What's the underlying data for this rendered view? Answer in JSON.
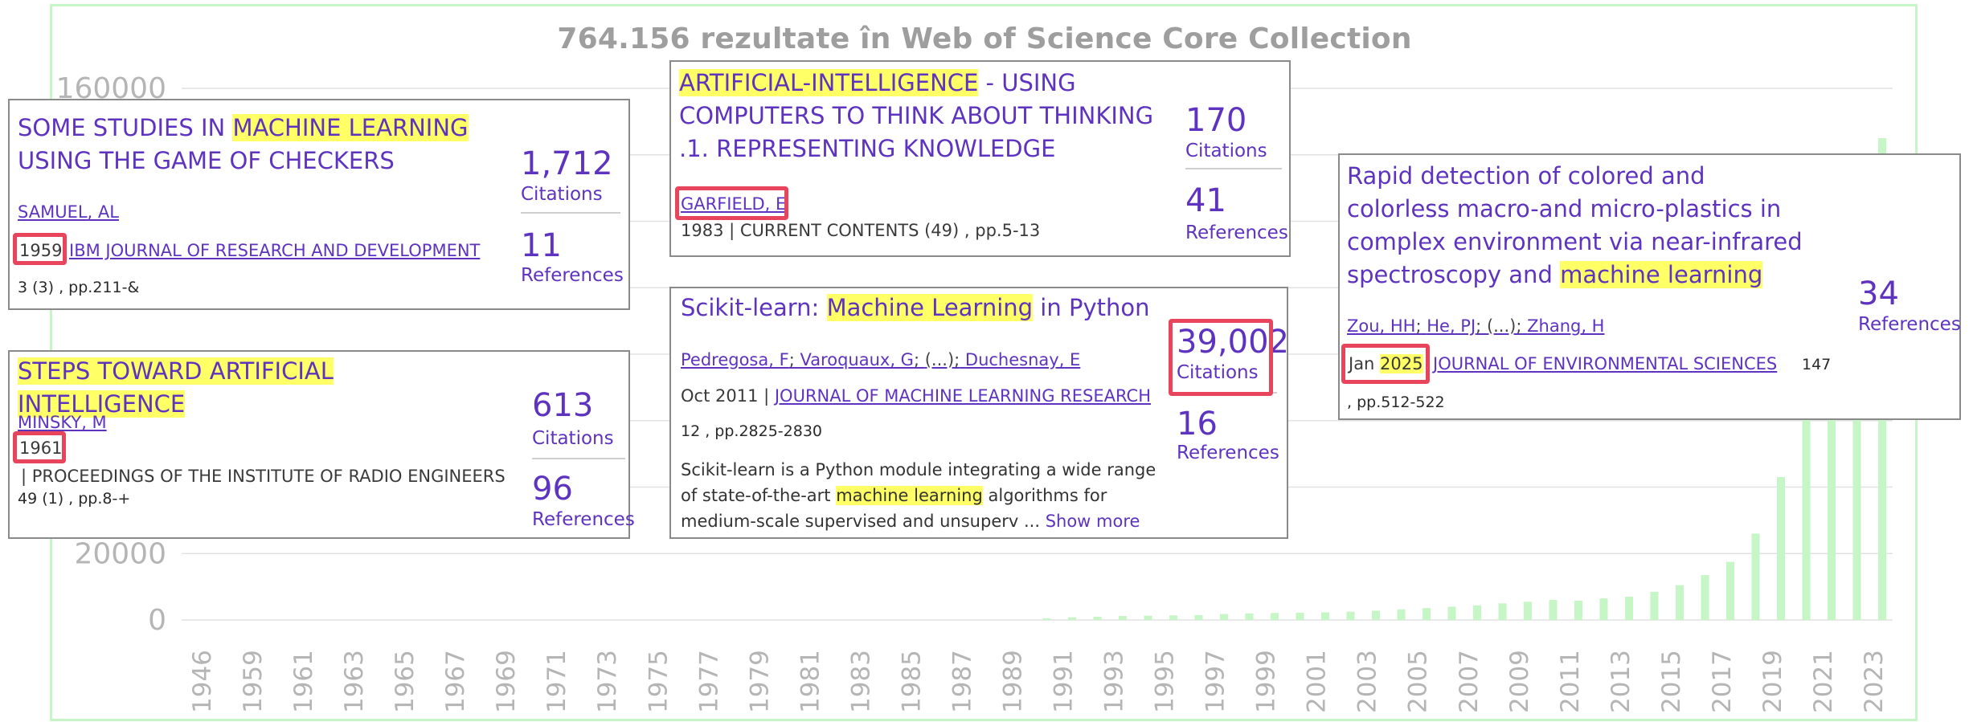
{
  "chart_data": {
    "type": "bar",
    "title": "764.156 rezultate în Web of Science Core Collection",
    "ylim": [
      0,
      160000
    ],
    "yticks": [
      "160000",
      "20000",
      "0"
    ],
    "xtick_labels": [
      "1946",
      "1959",
      "1961",
      "1963",
      "1965",
      "1967",
      "1969",
      "1971",
      "1973",
      "1975",
      "1977",
      "1979",
      "1981",
      "1983",
      "1985",
      "1987",
      "1989",
      "1991",
      "1993",
      "1995",
      "1997",
      "1999",
      "2001",
      "2003",
      "2005",
      "2007",
      "2009",
      "2011",
      "2013",
      "2015",
      "2017",
      "2019",
      "2021",
      "2023"
    ],
    "categories": [
      "1946",
      "1959",
      "1960",
      "1961",
      "1962",
      "1963",
      "1964",
      "1965",
      "1966",
      "1967",
      "1968",
      "1969",
      "1970",
      "1971",
      "1972",
      "1973",
      "1974",
      "1975",
      "1976",
      "1977",
      "1978",
      "1979",
      "1980",
      "1981",
      "1982",
      "1983",
      "1984",
      "1985",
      "1986",
      "1987",
      "1988",
      "1989",
      "1990",
      "1991",
      "1992",
      "1993",
      "1994",
      "1995",
      "1996",
      "1997",
      "1998",
      "1999",
      "2000",
      "2001",
      "2002",
      "2003",
      "2004",
      "2005",
      "2006",
      "2007",
      "2008",
      "2009",
      "2010",
      "2011",
      "2012",
      "2013",
      "2014",
      "2015",
      "2016",
      "2017",
      "2018",
      "2019",
      "2020",
      "2021",
      "2022",
      "2023"
    ],
    "values": [
      0,
      0,
      0,
      0,
      0,
      0,
      0,
      0,
      0,
      0,
      0,
      0,
      0,
      0,
      0,
      0,
      0,
      0,
      0,
      0,
      0,
      0,
      0,
      0,
      0,
      0,
      0,
      0,
      0,
      0,
      0,
      0,
      500,
      800,
      1000,
      1200,
      1300,
      1400,
      1500,
      1800,
      2000,
      2100,
      2200,
      2300,
      2500,
      2800,
      3200,
      3600,
      4000,
      4400,
      5000,
      5500,
      6000,
      5800,
      6500,
      7000,
      8500,
      10500,
      13500,
      17500,
      26000,
      43000,
      80000,
      110000,
      140000,
      145000
    ]
  },
  "color": {
    "bar": "#c6f5c6",
    "accent": "#5e33bf",
    "highlight": "#ffff66",
    "marker": "#e8455d"
  },
  "cards": {
    "samuel": {
      "title_a": "SOME STUDIES IN ",
      "title_hl": "MACHINE LEARNING",
      "title_b": " USING THE GAME OF CHECKERS",
      "author": "SAMUEL, AL",
      "year": "1959",
      "journal": "IBM JOURNAL OF RESEARCH AND DEVELOPMENT",
      "pages": "3 (3) , pp.211-&",
      "citations": "1,712",
      "citations_label": "Citations",
      "references": "11",
      "references_label": "References"
    },
    "minsky": {
      "title_hl": "STEPS TOWARD ARTIFICIAL INTELLIGENCE",
      "author": "MINSKY, M",
      "year": "1961",
      "journal": "| PROCEEDINGS OF THE INSTITUTE OF RADIO ENGINEERS",
      "pages": "49 (1) , pp.8-+",
      "citations": "613",
      "citations_label": "Citations",
      "references": "96",
      "references_label": "References"
    },
    "garfield": {
      "title_hl": "ARTIFICIAL-INTELLIGENCE",
      "title_b": " - USING COMPUTERS TO THINK ABOUT THINKING .1. REPRESENTING KNOWLEDGE",
      "author": "GARFIELD, E",
      "year": "1983",
      "journal": " | CURRENT CONTENTS (49) , pp.5-13",
      "citations": "170",
      "citations_label": "Citations",
      "references": "41",
      "references_label": "References"
    },
    "sklearn": {
      "title_a": "Scikit-learn: ",
      "title_hl": "Machine Learning",
      "title_b": " in Python",
      "author_1": "Pedregosa, F",
      "author_2": "Varoquaux, G",
      "author_etc": "(...);",
      "author_3": "Duchesnay, E",
      "date": "Oct 2011 | ",
      "journal": "JOURNAL OF MACHINE LEARNING RESEARCH",
      "pages": "12 , pp.2825-2830",
      "abstract_a": "Scikit-learn is a Python module integrating a wide range of state-of-the-art ",
      "abstract_hl": "machine learning",
      "abstract_b": " algorithms for medium-scale supervised and unsuperv ... ",
      "show_more": "Show more",
      "citations": "39,002",
      "citations_label": "Citations",
      "references": "16",
      "references_label": "References"
    },
    "zou": {
      "title_a": "Rapid detection of colored and colorless macro-and micro-plastics in complex environment via near-infrared spectroscopy and ",
      "title_hl": "machine learning",
      "author_1": "Zou, HH",
      "author_2": "He, PJ",
      "author_etc": "(...);",
      "author_3": "Zhang, H",
      "month": "Jan ",
      "year": "2025",
      "journal": "JOURNAL OF ENVIRONMENTAL SCIENCES",
      "volume": "147",
      "pages": ", pp.512-522",
      "references": "34",
      "references_label": "References"
    }
  }
}
